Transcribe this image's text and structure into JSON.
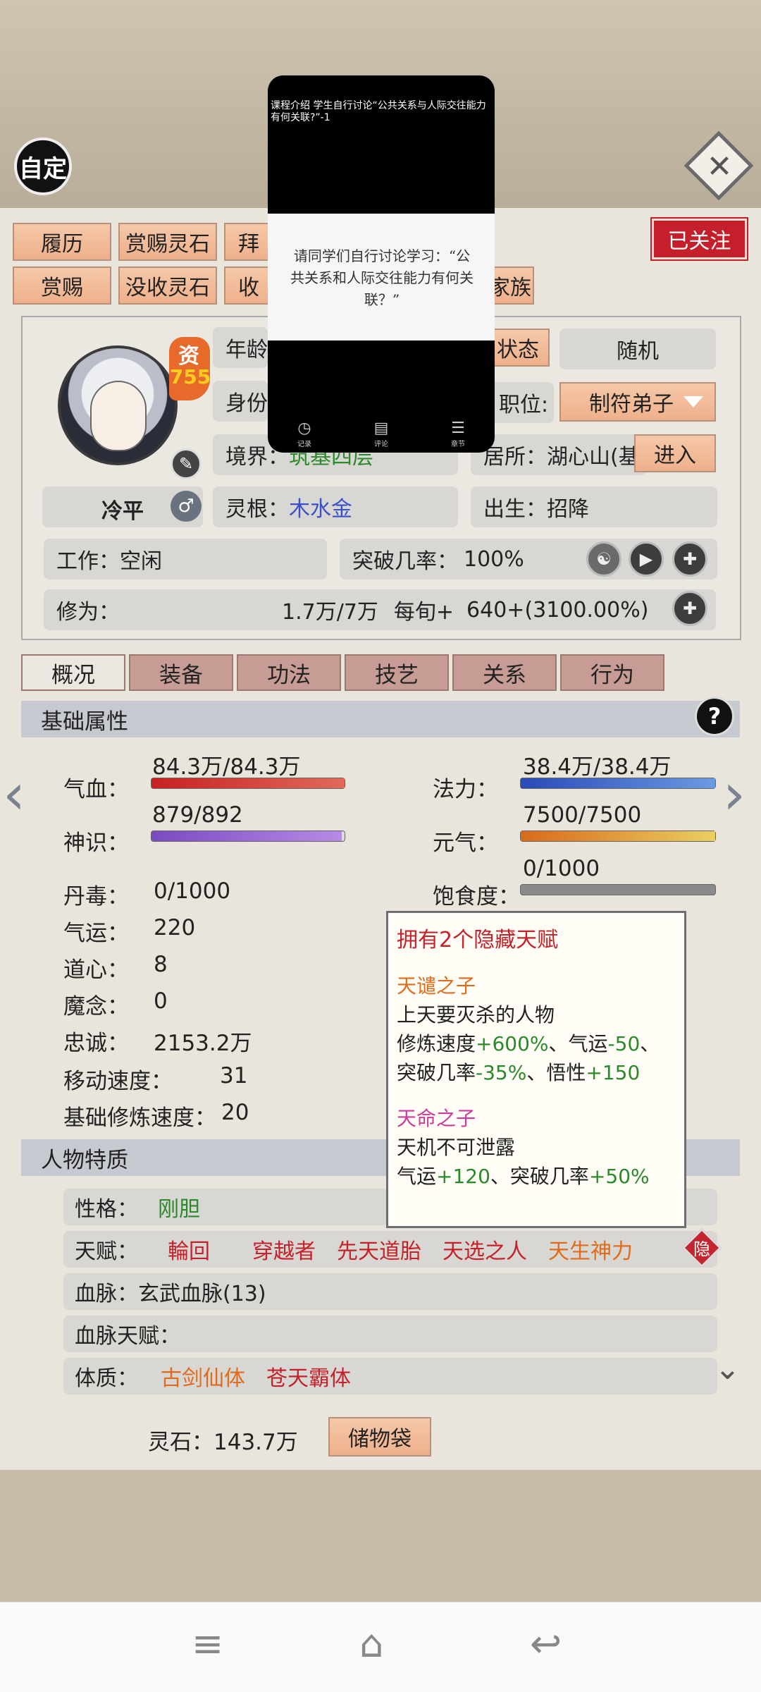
{
  "header": {
    "auto_label": "自定"
  },
  "top_buttons": [
    "履历",
    "赏赐灵石",
    "拜",
    "赏赐",
    "没收灵石",
    "收",
    "家族"
  ],
  "follow_label": "已关注",
  "character": {
    "resource_label": "资",
    "resource_value": "755",
    "name": "冷平",
    "age_label": "年龄",
    "identity_label": "身份",
    "realm_label": "境界：",
    "realm_value": "筑基四层",
    "root_label": "灵根：",
    "root_value": "木水金",
    "state_label": "状态",
    "random_label": "随机",
    "position_label": "职位:",
    "position_value": "制符弟子",
    "residence_label": "居所：湖心山(基",
    "enter_label": "进入",
    "birth_label": "出生：",
    "birth_value": "招降",
    "work_label": "工作：空闲",
    "break_label": "突破几率：",
    "break_value": "100%",
    "cultivation_label": "修为：",
    "cultivation_value": "1.7万/7万",
    "per_turn_label": "每旬+",
    "per_turn_value": "640+(3100.00%)"
  },
  "tabs": [
    "概况",
    "装备",
    "功法",
    "技艺",
    "关系",
    "行为"
  ],
  "basic": {
    "section_title": "基础属性",
    "hp_label": "气血：",
    "hp_value": "84.3万/84.3万",
    "hp_fill": 1.0,
    "mana_label": "法力：",
    "mana_value": "38.4万/38.4万",
    "mana_fill": 1.0,
    "sense_label": "神识：",
    "sense_value": "879/892",
    "sense_fill": 0.985,
    "vital_label": "元气：",
    "vital_value": "7500/7500",
    "vital_fill": 1.0,
    "hunger_label": "饱食度：",
    "hunger_value": "0/1000",
    "hunger_fill": 0.0,
    "poison_label": "丹毒：",
    "poison_value": "0/1000",
    "luck_label": "气运：",
    "luck_value": "220",
    "dao_label": "道心：",
    "dao_value": "8",
    "demon_label": "魔念：",
    "demon_value": "0",
    "loyal_label": "忠诚：",
    "loyal_value": "2153.2万",
    "speed_label": "移动速度：",
    "speed_value": "31",
    "base_rate_label": "基础修炼速度：",
    "base_rate_value": "20"
  },
  "tooltip": {
    "title": "拥有2个隐藏天赋",
    "t1_name": "天谴之子",
    "t1_desc": "上天要灭杀的人物",
    "t1_line1_a": "修炼速度",
    "t1_line1_b": "+600%",
    "t1_line1_c": "、气运",
    "t1_line1_d": "-50",
    "t1_line1_e": "、",
    "t1_line2_a": "突破几率",
    "t1_line2_b": "-35%",
    "t1_line2_c": "、悟性",
    "t1_line2_d": "+150",
    "t2_name": "天命之子",
    "t2_desc": "天机不可泄露",
    "t2_line_a": "气运",
    "t2_line_b": "+120",
    "t2_line_c": "、突破几率",
    "t2_line_d": "+50%"
  },
  "traits": {
    "section_title": "人物特质",
    "personality_label": "性格：",
    "personality_value": "刚胆",
    "talent_label": "天赋：",
    "talents": [
      "輪回",
      "穿越者",
      "先天道胎",
      "天选之人",
      "天生神力"
    ],
    "hide_label": "隐",
    "bloodline_label": "血脉：玄武血脉(13)",
    "bloodline_talent_label": "血脉天赋：",
    "physique_label": "体质：",
    "physique_values": [
      "古剑仙体",
      "苍天霸体"
    ]
  },
  "footer": {
    "stones_label": "灵石：",
    "stones_value": "143.7万",
    "bag_label": "储物袋"
  },
  "popup": {
    "title": "课程介绍 学生自行讨论“公共关系与人际交往能力有何关联?”-1",
    "body": "请同学们自行讨论学习：“公共关系和人际交往能力有何关联？”",
    "nav": [
      "记录",
      "评论",
      "章节"
    ]
  }
}
